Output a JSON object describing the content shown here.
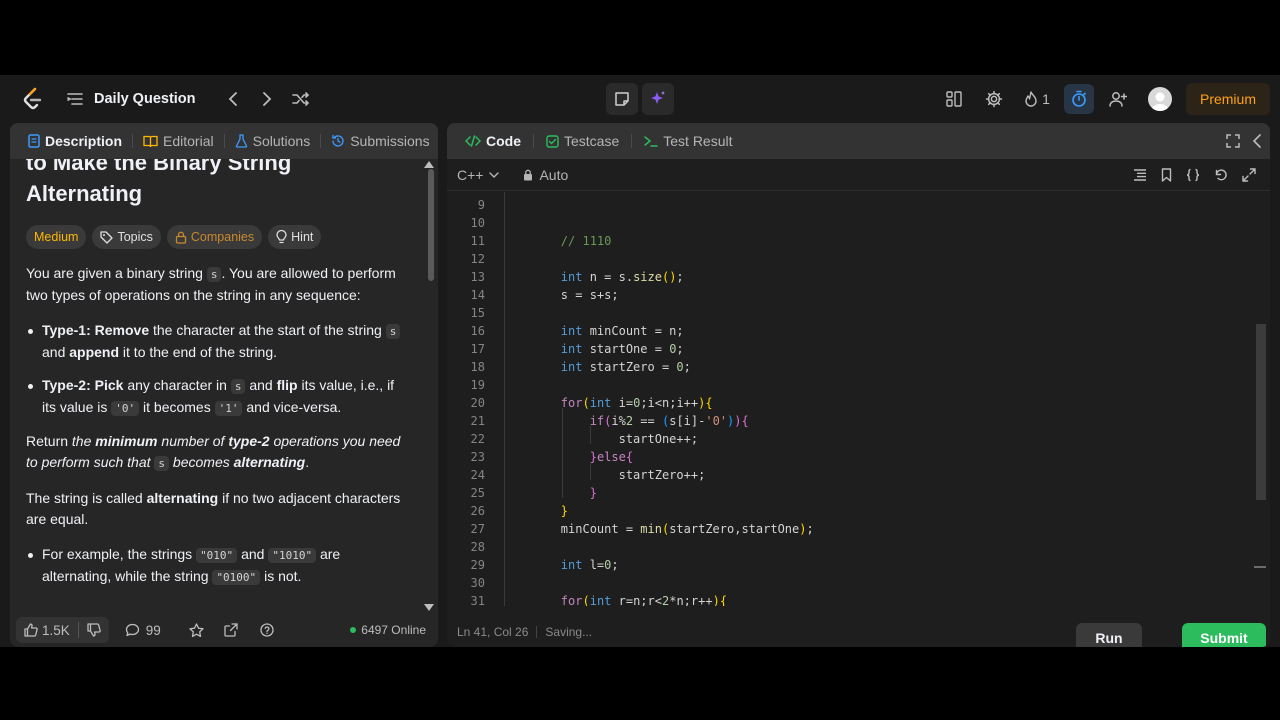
{
  "topbar": {
    "title": "Daily Question",
    "streak": "1",
    "premium": "Premium"
  },
  "left_tabs": [
    {
      "label": "Description"
    },
    {
      "label": "Editorial"
    },
    {
      "label": "Solutions"
    },
    {
      "label": "Submissions"
    }
  ],
  "problem": {
    "title_line1": "to Make the Binary String",
    "title_line2": "Alternating",
    "tags": {
      "difficulty": "Medium",
      "topics": "Topics",
      "companies": "Companies",
      "hint": "Hint"
    },
    "p1_a": "You are given a binary string ",
    "p1_code": "s",
    "p1_b": ". You are allowed to perform two types of operations on the string in any sequence:",
    "li1_b1": "Type-1: Remove",
    "li1_t1": " the character at the start of the string ",
    "li1_code": "s",
    "li1_t2": " and ",
    "li1_b2": "append",
    "li1_t3": " it to the end of the string.",
    "li2_b1": "Type-2: Pick",
    "li2_t1": " any character in ",
    "li2_code1": "s",
    "li2_t2": " and ",
    "li2_b2": "flip",
    "li2_t3": " its value, i.e., if its value is ",
    "li2_code2": "'0'",
    "li2_t4": " it becomes ",
    "li2_code3": "'1'",
    "li2_t5": " and vice-versa.",
    "p2_t1": "Return ",
    "p2_e1": "the ",
    "p2_b1": "minimum",
    "p2_e2": " number of ",
    "p2_b2": "type-2",
    "p2_e3": " operations you need to perform such that ",
    "p2_code": "s",
    "p2_e4": " becomes ",
    "p2_b3": "alternating",
    "p2_t2": ".",
    "p3_t1": "The string is called ",
    "p3_b": "alternating",
    "p3_t2": " if no two adjacent characters are equal.",
    "li3_t1": "For example, the strings ",
    "li3_code1": "\"010\"",
    "li3_t2": " and ",
    "li3_code2": "\"1010\"",
    "li3_t3": " are alternating, while the string ",
    "li3_code3": "\"0100\"",
    "li3_t4": " is not."
  },
  "left_footer": {
    "likes": "1.5K",
    "comments": "99",
    "online": "6497 Online"
  },
  "right_tabs": [
    {
      "label": "Code"
    },
    {
      "label": "Testcase"
    },
    {
      "label": "Test Result"
    }
  ],
  "editor": {
    "language": "C++",
    "mode": "Auto",
    "status_position": "Ln 41, Col 26",
    "status_saving": "Saving...",
    "run": "Run",
    "submit": "Submit",
    "line_numbers": [
      "9",
      "10",
      "11",
      "12",
      "13",
      "14",
      "15",
      "16",
      "17",
      "18",
      "19",
      "20",
      "21",
      "22",
      "23",
      "24",
      "25",
      "26",
      "27",
      "28",
      "29",
      "30",
      "31"
    ]
  },
  "colors": {
    "accent_orange": "#ffa116",
    "submit_green": "#2cbb5d",
    "medium_yellow": "#ffb800",
    "timer_blue": "#3b9cff"
  }
}
